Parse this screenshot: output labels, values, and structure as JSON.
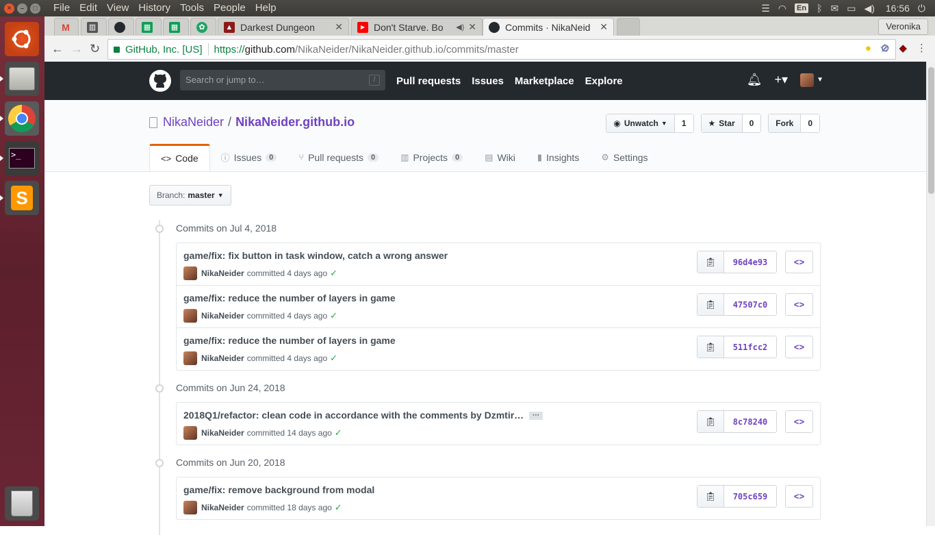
{
  "os_panel": {
    "menu": [
      "File",
      "Edit",
      "View",
      "History",
      "Tools",
      "People",
      "Help"
    ],
    "keyboard_layout": "En",
    "clock": "16:56"
  },
  "browser": {
    "tabs": [
      {
        "title": "",
        "icon": "gmail-icon",
        "color": "#db4437"
      },
      {
        "title": "",
        "icon": "trello-icon",
        "color": "#555555"
      },
      {
        "title": "",
        "icon": "github-icon",
        "color": "#24292e"
      },
      {
        "title": "",
        "icon": "sheets-icon",
        "color": "#0f9d58"
      },
      {
        "title": "",
        "icon": "sheets-icon",
        "color": "#0f9d58"
      },
      {
        "title": "",
        "icon": "app-icon",
        "color": "#21a366"
      },
      {
        "title": "Darkest Dungeon",
        "icon": "darkest-dungeon-icon",
        "color": "#8b1a1a"
      },
      {
        "title": "Don't Starve. Bo",
        "icon": "youtube-icon",
        "color": "#ff0000"
      },
      {
        "title": "Commits · NikaNeid",
        "icon": "github-icon",
        "color": "#24292e"
      }
    ],
    "profile": "Veronika",
    "secure_label": "GitHub, Inc. [US]",
    "url": {
      "proto": "https://",
      "host": "github.com",
      "path": "/NikaNeider/NikaNeider.github.io/commits/master"
    }
  },
  "github": {
    "search_placeholder": "Search or jump to…",
    "search_key": "/",
    "nav": [
      "Pull requests",
      "Issues",
      "Marketplace",
      "Explore"
    ],
    "repo": {
      "owner": "NikaNeider",
      "separator": "/",
      "name": "NikaNeider.github.io"
    },
    "actions": {
      "watch_label": "Unwatch",
      "watch_count": "1",
      "star_label": "Star",
      "star_count": "0",
      "fork_label": "Fork",
      "fork_count": "0"
    },
    "tabs": [
      {
        "label": "Code",
        "counter": ""
      },
      {
        "label": "Issues",
        "counter": "0"
      },
      {
        "label": "Pull requests",
        "counter": "0"
      },
      {
        "label": "Projects",
        "counter": "0"
      },
      {
        "label": "Wiki",
        "counter": ""
      },
      {
        "label": "Insights",
        "counter": ""
      },
      {
        "label": "Settings",
        "counter": ""
      }
    ],
    "branch": {
      "label": "Branch:",
      "value": "master"
    }
  },
  "commit_groups": [
    {
      "title": "Commits on Jul 4, 2018",
      "commits": [
        {
          "message": "game/fix: fix button in task window, catch a wrong answer",
          "author": "NikaNeider",
          "verb": "committed",
          "time": "4 days ago",
          "sha": "96d4e93"
        },
        {
          "message": "game/fix: reduce the number of layers in game",
          "author": "NikaNeider",
          "verb": "committed",
          "time": "4 days ago",
          "sha": "47507c0"
        },
        {
          "message": "game/fix: reduce the number of layers in game",
          "author": "NikaNeider",
          "verb": "committed",
          "time": "4 days ago",
          "sha": "511fcc2"
        }
      ]
    },
    {
      "title": "Commits on Jun 24, 2018",
      "commits": [
        {
          "message": "2018Q1/refactor: clean code in accordance with the comments by Dzmtir…",
          "author": "NikaNeider",
          "verb": "committed",
          "time": "14 days ago",
          "sha": "8c78240",
          "ellipsis": "···"
        }
      ]
    },
    {
      "title": "Commits on Jun 20, 2018",
      "commits": [
        {
          "message": "game/fix: remove background from modal",
          "author": "NikaNeider",
          "verb": "committed",
          "time": "18 days ago",
          "sha": "705c659"
        }
      ]
    }
  ]
}
